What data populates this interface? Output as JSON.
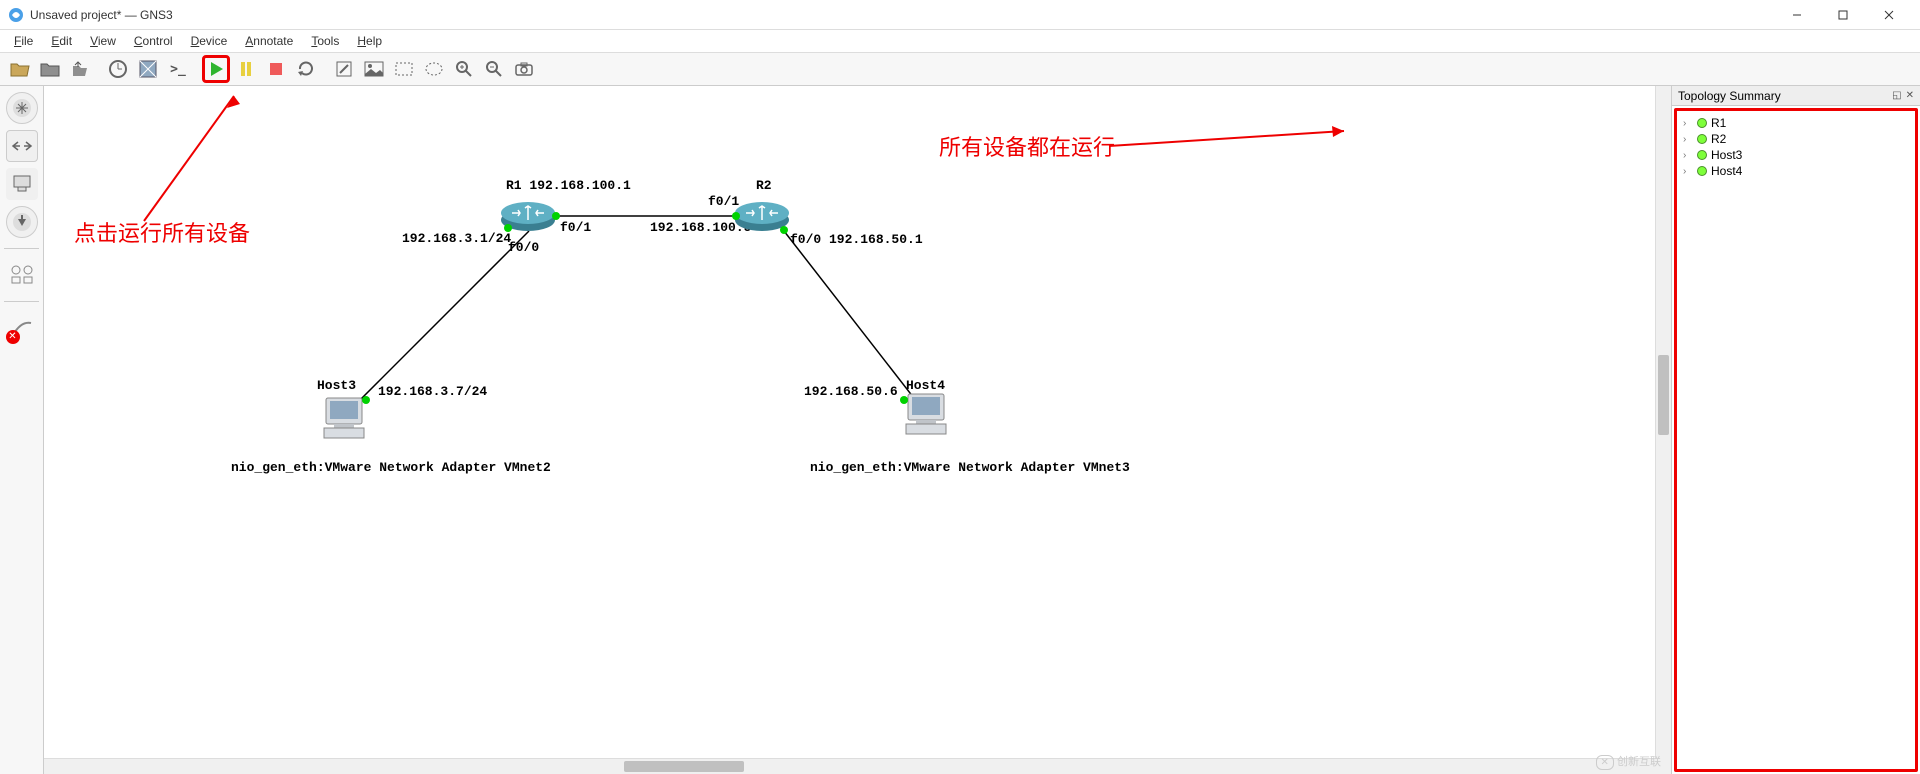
{
  "title": "Unsaved project* — GNS3",
  "menus": [
    "File",
    "Edit",
    "View",
    "Control",
    "Device",
    "Annotate",
    "Tools",
    "Help"
  ],
  "annotations": {
    "left_text": "点击运行所有设备",
    "right_text": "所有设备都在运行"
  },
  "panel": {
    "title": "Topology Summary",
    "items": [
      "R1",
      "R2",
      "Host3",
      "Host4"
    ]
  },
  "topology": {
    "devices": {
      "R1": {
        "label": "R1  192.168.100.1"
      },
      "R2": {
        "label": "R2"
      },
      "Host3": {
        "label": "Host3"
      },
      "Host4": {
        "label": "Host4"
      }
    },
    "labels": {
      "r1_f01": "f0/1",
      "r1_f00": "f0/0",
      "r2_f01": "f0/1",
      "r2_f00": "f0/0 192.168.50.1",
      "h3_ip": "192.168.3.7/24",
      "h4_ip": "192.168.50.6",
      "r1_lan_ip": "192.168.3.1/24",
      "link_mid_ip": "192.168.100.5",
      "h3_adapter": "nio_gen_eth:VMware Network Adapter VMnet2",
      "h4_adapter": "nio_gen_eth:VMware Network Adapter VMnet3"
    }
  },
  "watermark": {
    "brand": "创新互联"
  }
}
